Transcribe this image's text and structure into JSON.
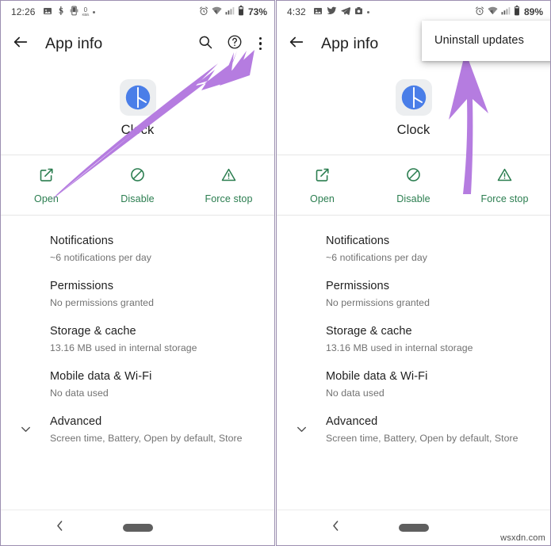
{
  "watermark": "wsxdn.com",
  "colors": {
    "accent_green": "#2a7d4f",
    "arrow_purple": "#b57ce0",
    "app_icon_blue": "#4a7ee8",
    "panel_border": "#9c8fb0",
    "text_primary": "#1f1f1f",
    "text_secondary": "#727272"
  },
  "panels": [
    {
      "id": "left",
      "status_bar": {
        "time": "12:26",
        "left_icons": [
          "image-icon",
          "stripe-s-icon",
          "phone-vibrate-icon",
          "network-speed-icon",
          "dot-icon"
        ],
        "network_speed_value": "0",
        "network_speed_unit": "KB/s",
        "right_icons": [
          "alarm-icon",
          "wifi-icon",
          "signal-icon",
          "battery-icon"
        ],
        "battery": "73%"
      },
      "app_bar": {
        "back_icon": "arrow-left-icon",
        "title": "App info",
        "actions": [
          "search-icon",
          "help-icon",
          "overflow-menu-icon"
        ]
      },
      "app_identity": {
        "icon": "clock-app-icon",
        "name": "Clock"
      },
      "actions": [
        {
          "icon": "open-external-icon",
          "label": "Open"
        },
        {
          "icon": "disable-slash-icon",
          "label": "Disable"
        },
        {
          "icon": "force-stop-warning-icon",
          "label": "Force stop"
        }
      ],
      "list": [
        {
          "title": "Notifications",
          "subtitle": "~6 notifications per day",
          "expand_icon": ""
        },
        {
          "title": "Permissions",
          "subtitle": "No permissions granted",
          "expand_icon": ""
        },
        {
          "title": "Storage & cache",
          "subtitle": "13.16 MB used in internal storage",
          "expand_icon": ""
        },
        {
          "title": "Mobile data & Wi-Fi",
          "subtitle": "No data used",
          "expand_icon": ""
        },
        {
          "title": "Advanced",
          "subtitle": "Screen time, Battery, Open by default, Store",
          "expand_icon": "chevron-down-icon"
        }
      ],
      "nav_bar": {
        "back_icon": "nav-back-icon",
        "home_handle": "home-pill-handle"
      },
      "popup_menu": null,
      "annotation_arrow": {
        "type": "diagonal-up-right-arrow",
        "points_to": "overflow-menu-icon"
      }
    },
    {
      "id": "right",
      "status_bar": {
        "time": "4:32",
        "left_icons": [
          "image-icon",
          "twitter-icon",
          "telegram-icon",
          "camera-icon",
          "dot-icon"
        ],
        "network_speed_value": "",
        "network_speed_unit": "",
        "right_icons": [
          "alarm-icon",
          "wifi-icon",
          "signal-icon",
          "battery-icon"
        ],
        "battery": "89%"
      },
      "app_bar": {
        "back_icon": "arrow-left-icon",
        "title": "App info",
        "actions": []
      },
      "app_identity": {
        "icon": "clock-app-icon",
        "name": "Clock"
      },
      "actions": [
        {
          "icon": "open-external-icon",
          "label": "Open"
        },
        {
          "icon": "disable-slash-icon",
          "label": "Disable"
        },
        {
          "icon": "force-stop-warning-icon",
          "label": "Force stop"
        }
      ],
      "list": [
        {
          "title": "Notifications",
          "subtitle": "~6 notifications per day",
          "expand_icon": ""
        },
        {
          "title": "Permissions",
          "subtitle": "No permissions granted",
          "expand_icon": ""
        },
        {
          "title": "Storage & cache",
          "subtitle": "13.16 MB used in internal storage",
          "expand_icon": ""
        },
        {
          "title": "Mobile data & Wi-Fi",
          "subtitle": "No data used",
          "expand_icon": ""
        },
        {
          "title": "Advanced",
          "subtitle": "Screen time, Battery, Open by default, Store",
          "expand_icon": "chevron-down-icon"
        }
      ],
      "nav_bar": {
        "back_icon": "nav-back-icon",
        "home_handle": "home-pill-handle"
      },
      "popup_menu": {
        "items": [
          "Uninstall updates"
        ]
      },
      "annotation_arrow": {
        "type": "vertical-up-arrow",
        "points_to": "uninstall-updates-menu-item"
      }
    }
  ]
}
